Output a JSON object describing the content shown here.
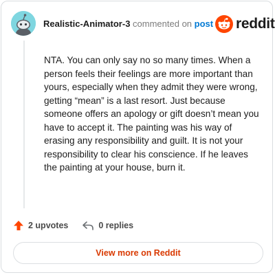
{
  "header": {
    "author": "Realistic-Animator-3",
    "commented_text": "commented on",
    "post_link": "post",
    "brand_word": "reddit"
  },
  "icons": {
    "avatar": "snoo-avatar-icon",
    "brand": "reddit-logo-icon",
    "upvote": "upvote-arrow-icon",
    "reply": "reply-arrow-icon"
  },
  "comment": {
    "body": "NTA. You can only say no so many times. When a person feels their feelings are more important than yours, especially when they admit they were wrong, getting “mean” is a last resort. Just because someone offers an apology or gift doesn’t mean you have to accept it. The painting was his way of erasing any responsibility and guilt. It is not your responsibility to clear his conscience. If he leaves the painting at your house, burn it."
  },
  "footer": {
    "upvotes": "2 upvotes",
    "replies": "0 replies",
    "view_more": "View more on Reddit"
  },
  "colors": {
    "brand_orange": "#ff4500",
    "link_blue": "#0079d3",
    "avatar_bg": "#7fd6e0",
    "view_more_text": "#d93900"
  }
}
